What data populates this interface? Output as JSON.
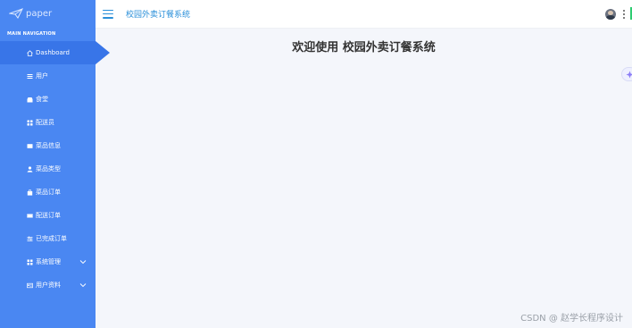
{
  "brand": {
    "logo_text": "paper"
  },
  "sidebar": {
    "header": "MAIN NAVIGATION",
    "items": [
      {
        "label": "Dashboard",
        "icon": "home-icon",
        "active": true
      },
      {
        "label": "用户",
        "icon": "list-icon"
      },
      {
        "label": "食堂",
        "icon": "shop-icon"
      },
      {
        "label": "配送员",
        "icon": "grid-icon"
      },
      {
        "label": "菜品信息",
        "icon": "card-icon"
      },
      {
        "label": "菜品类型",
        "icon": "user-icon"
      },
      {
        "label": "菜品订单",
        "icon": "bag-icon"
      },
      {
        "label": "配送订单",
        "icon": "ticket-icon"
      },
      {
        "label": "已完成订单",
        "icon": "sliders-icon"
      },
      {
        "label": "系统管理",
        "icon": "grid-icon",
        "expandable": true
      },
      {
        "label": "用户资料",
        "icon": "id-card-icon",
        "expandable": true
      }
    ]
  },
  "topbar": {
    "title": "校园外卖订餐系统"
  },
  "main": {
    "welcome": "欢迎使用 校园外卖订餐系统"
  },
  "watermark": "CSDN @ 赵学长程序设计",
  "colors": {
    "sidebar": "#4a87f2",
    "active": "#3875e8",
    "title": "#2a8fd9",
    "background": "#f4f6fb"
  }
}
